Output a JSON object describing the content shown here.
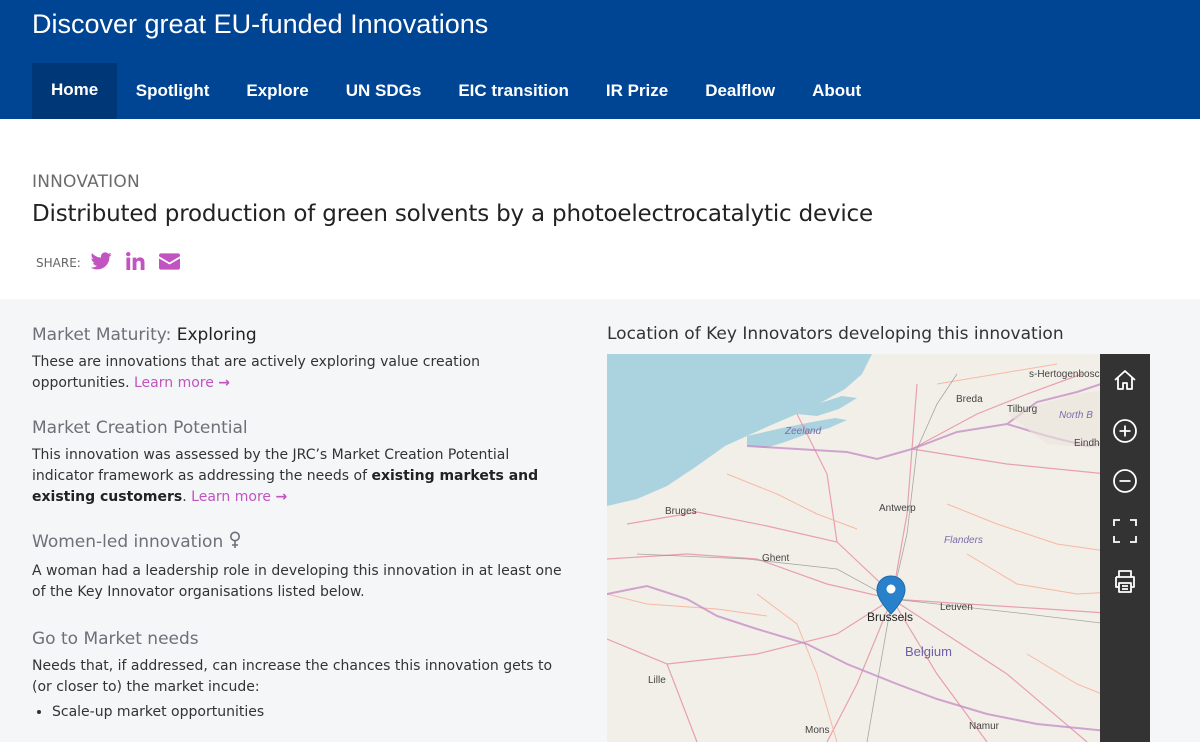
{
  "header": {
    "title": "Discover great EU-funded Innovations",
    "nav": [
      "Home",
      "Spotlight",
      "Explore",
      "UN SDGs",
      "EIC transition",
      "IR Prize",
      "Dealflow",
      "About"
    ]
  },
  "innovation": {
    "eyebrow": "INNOVATION",
    "title": "Distributed production of green solvents by a photoelectrocatalytic device",
    "share_label": "SHARE:"
  },
  "maturity": {
    "heading": "Market Maturity:",
    "value": "Exploring",
    "text": "These are innovations that are actively exploring value creation opportunities.",
    "learn_more": "Learn more"
  },
  "mcp": {
    "heading": "Market Creation Potential",
    "text_before": "This innovation was assessed by the JRC’s Market Creation Potential indicator framework as addressing the needs of",
    "text_bold": "existing markets and existing customers",
    "text_after": ".",
    "learn_more": "Learn more"
  },
  "women": {
    "heading": "Women-led innovation",
    "text": "A woman had a leadership role in developing this innovation in at least one of the Key Innovator organisations listed below."
  },
  "gtm": {
    "heading": "Go to Market needs",
    "text": "Needs that, if addressed, can increase the chances this innovation gets to (or closer to) the market incude:",
    "items": [
      "Scale-up market opportunities"
    ]
  },
  "map": {
    "title": "Location of Key Innovators developing this innovation",
    "labels": {
      "hertogenbosch": "s-Hertogenbosc",
      "breda": "Breda",
      "tilburg": "Tilburg",
      "north_b": "North B",
      "eindh": "Eindh",
      "zeeland": "Zeeland",
      "antwerp": "Antwerp",
      "bruges": "Bruges",
      "flanders": "Flanders",
      "ghent": "Ghent",
      "brussels": "Brussels",
      "leuven": "Leuven",
      "belgium": "Belgium",
      "lille": "Lille",
      "mons": "Mons",
      "namur": "Namur"
    },
    "controls": [
      "home-icon",
      "zoom-in-icon",
      "zoom-out-icon",
      "fullscreen-icon",
      "print-icon"
    ]
  },
  "colors": {
    "header_bg": "#004494",
    "nav_active": "#003776",
    "accent": "#c154c1",
    "marker": "#2a81cb",
    "sea": "#aad3df"
  }
}
